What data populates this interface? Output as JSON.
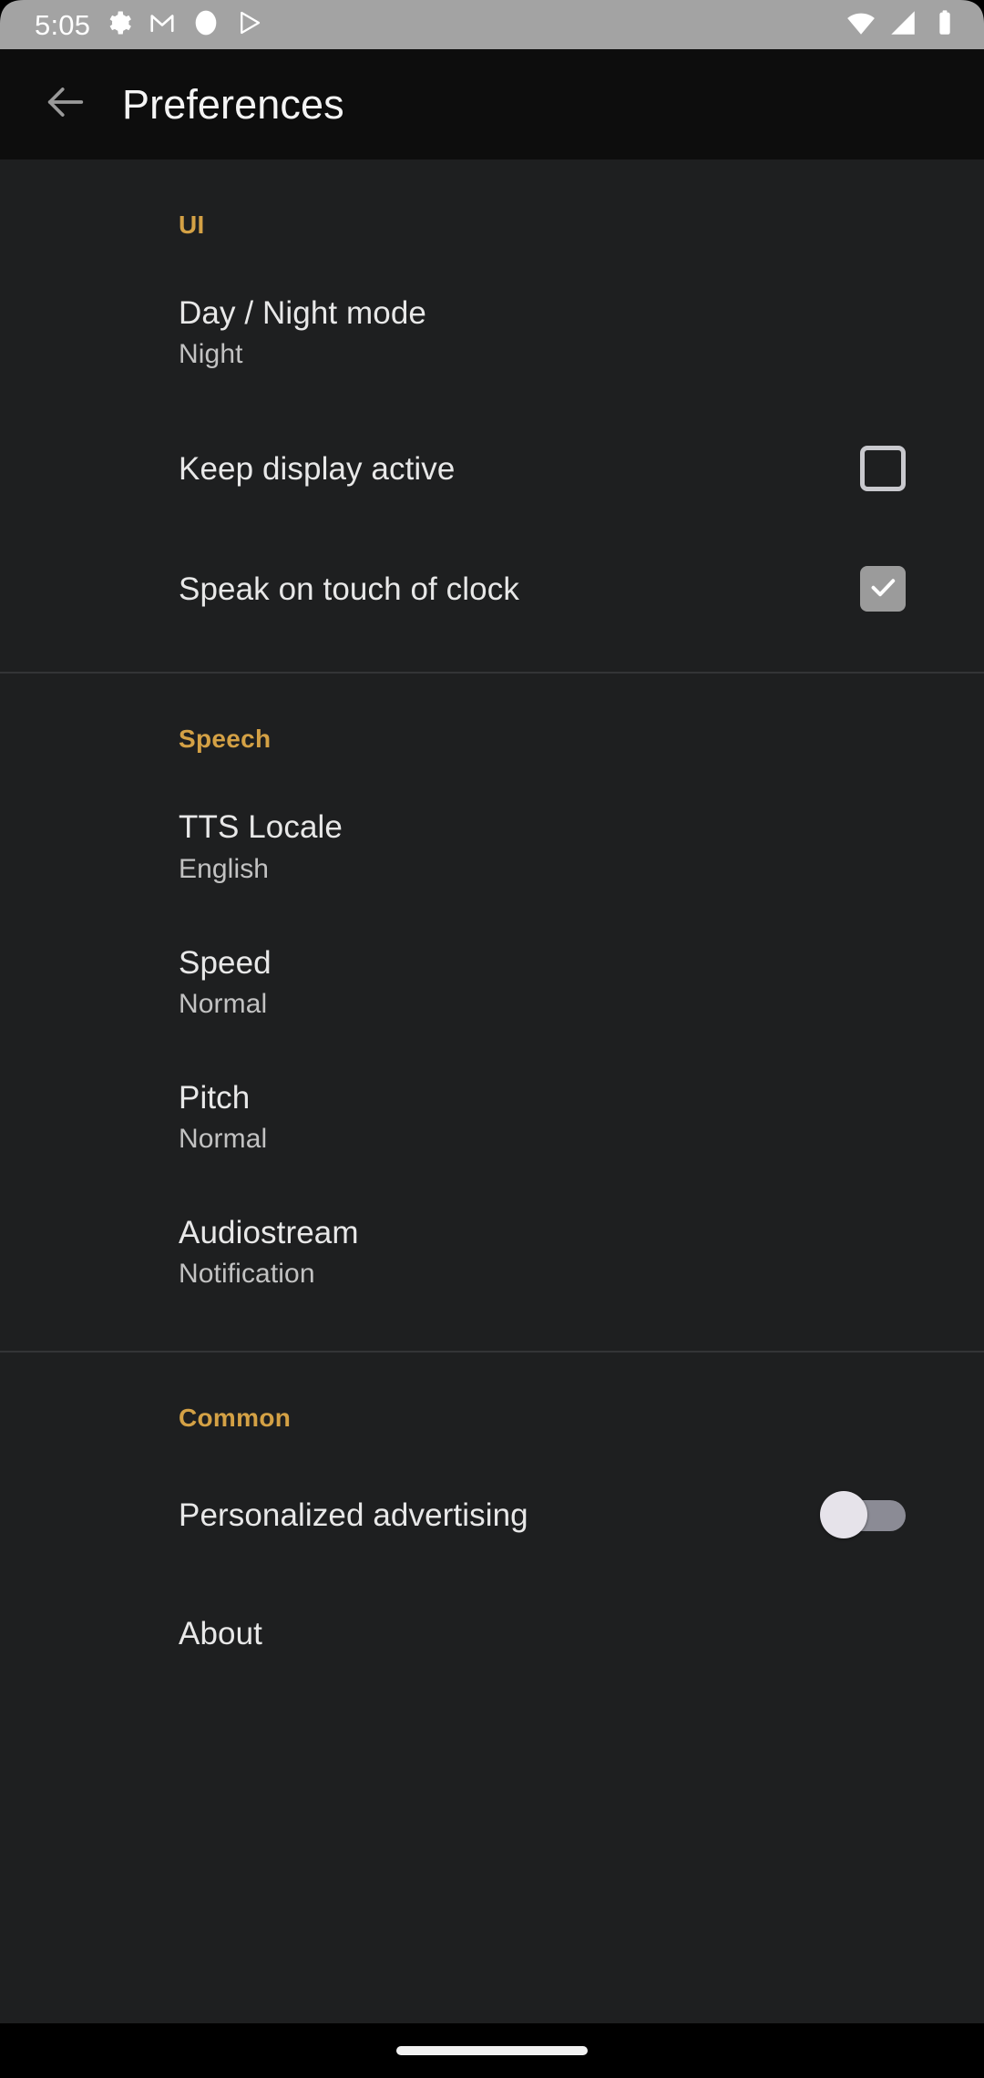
{
  "status_bar": {
    "time": "5:05",
    "left_icons": [
      "gear-icon",
      "gmail-icon",
      "circle-icon",
      "play-store-icon"
    ],
    "right_icons": [
      "wifi-icon",
      "cell-signal-icon",
      "battery-icon"
    ],
    "background_color": "#a3a3a3"
  },
  "app_bar": {
    "back_label": "back-arrow-icon",
    "title": "Preferences",
    "background_color": "#0d0d0d"
  },
  "theme": {
    "section_header_color": "#d4a145",
    "page_background": "#1e1f20",
    "title_text_color": "#e8e8e8",
    "summary_text_color": "#c2c2c2",
    "checkbox_checked_color": "#9b9b9b",
    "switch_thumb_color": "#e6e3ea",
    "switch_track_color": "#8b8b95"
  },
  "sections": [
    {
      "header": "UI",
      "items": [
        {
          "title": "Day / Night mode",
          "summary": "Night",
          "widget": "none"
        },
        {
          "title": "Keep display active",
          "summary": "",
          "widget": "checkbox",
          "checked": false
        },
        {
          "title": "Speak on touch of clock",
          "summary": "",
          "widget": "checkbox",
          "checked": true
        }
      ]
    },
    {
      "header": "Speech",
      "items": [
        {
          "title": "TTS Locale",
          "summary": "English",
          "widget": "none"
        },
        {
          "title": "Speed",
          "summary": "Normal",
          "widget": "none"
        },
        {
          "title": "Pitch",
          "summary": "Normal",
          "widget": "none"
        },
        {
          "title": "Audiostream",
          "summary": "Notification",
          "widget": "none"
        }
      ]
    },
    {
      "header": "Common",
      "items": [
        {
          "title": "Personalized advertising",
          "summary": "",
          "widget": "switch",
          "checked": false
        },
        {
          "title": "About",
          "summary": "",
          "widget": "none"
        }
      ]
    }
  ],
  "nav_bar": {
    "gesture_pill": "home-gesture-pill"
  }
}
